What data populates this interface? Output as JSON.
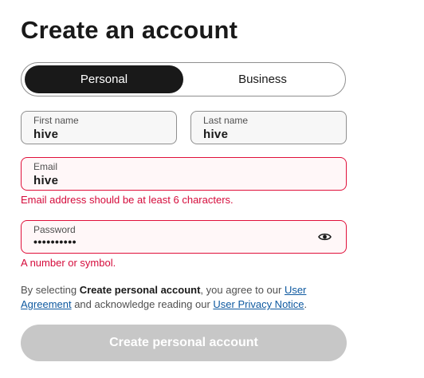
{
  "page": {
    "title": "Create an account"
  },
  "account_type": {
    "options": [
      "Personal",
      "Business"
    ],
    "selected": "Personal"
  },
  "form": {
    "first_name": {
      "label": "First name",
      "value": "hive"
    },
    "last_name": {
      "label": "Last name",
      "value": "hive"
    },
    "email": {
      "label": "Email",
      "value": "hive",
      "error": "Email address should be at least 6 characters."
    },
    "password": {
      "label": "Password",
      "value": "••••••••••",
      "error": "A number or symbol.",
      "toggle_icon": "eye-icon"
    }
  },
  "legal": {
    "prefix": "By selecting ",
    "action_name": "Create personal account",
    "middle": ", you agree to our ",
    "user_agreement": "User Agreement",
    "middle2": " and acknowledge reading our ",
    "privacy_notice": "User Privacy Notice",
    "suffix": "."
  },
  "submit": {
    "label": "Create personal account"
  },
  "colors": {
    "error": "#d50b3b",
    "link": "#0e59a0",
    "active_segment": "#191919",
    "disabled_button": "#c7c7c7"
  }
}
